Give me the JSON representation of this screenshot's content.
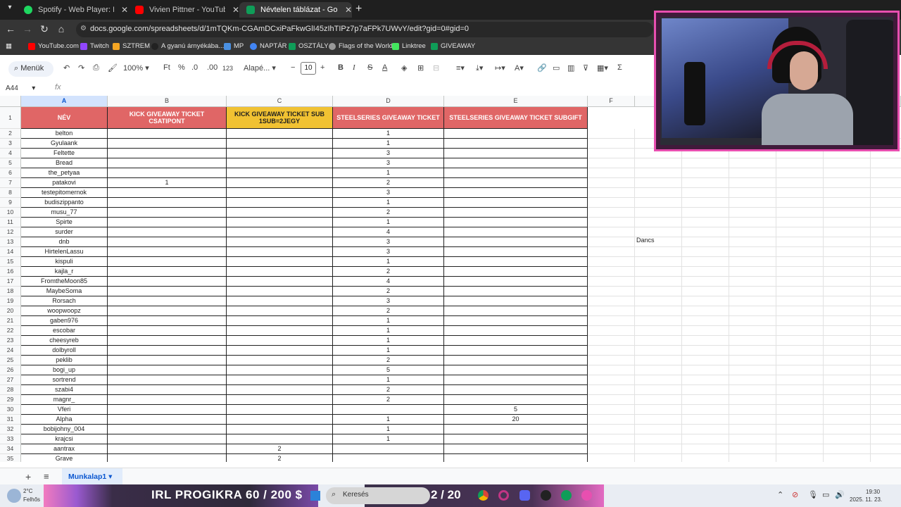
{
  "browser": {
    "tabs": [
      {
        "title": "Spotify - Web Player: Music for",
        "color": "#1ed760",
        "active": false
      },
      {
        "title": "Vivien Pittner - YouTube",
        "color": "#ff0000",
        "active": false
      },
      {
        "title": "Névtelen táblázat - Google Tábl",
        "color": "#0f9d58",
        "active": true
      }
    ],
    "new_tab": "+",
    "url": "docs.google.com/spreadsheets/d/1mTQKm-CGAmDCxiPaFkwGlI45zIhTIPz7p7aFPk7UWvY/edit?gid=0#gid=0",
    "bookmarks": [
      {
        "label": "YouTube.com",
        "color": "#ff0000"
      },
      {
        "label": "Twitch",
        "color": "#9146ff"
      },
      {
        "label": "SZTREM",
        "color": "#f5a623"
      },
      {
        "label": "A gyanú árnyékába...",
        "color": "#222222"
      },
      {
        "label": "MP",
        "color": "#4a90e2"
      },
      {
        "label": "NAPTÁR",
        "color": "#4285f4"
      },
      {
        "label": "OSZTÁLY",
        "color": "#0f9d58"
      },
      {
        "label": "Flags of the World",
        "color": "#999999"
      },
      {
        "label": "Linktree",
        "color": "#43e55e"
      },
      {
        "label": "GIVEAWAY",
        "color": "#0f9d58"
      }
    ]
  },
  "toolbar": {
    "menus": "Menük",
    "zoom": "100%",
    "currency": "Ft",
    "percent": "%",
    "dec_minus": ".0",
    "dec_plus": ".00",
    "num_format": "123",
    "font": "Alapé...",
    "font_size": "10",
    "bold": "B",
    "italic": "I",
    "strike": "S",
    "text_color": "A"
  },
  "formula_bar": {
    "name_box": "A44",
    "fx": "fx",
    "value": ""
  },
  "columns": [
    "A",
    "B",
    "C",
    "D",
    "E",
    "F"
  ],
  "header_row": {
    "A": "NÉV",
    "B": "KICK GIVEAWAY TICKET CSATIPONT",
    "C": "KICK GIVEAWAY TICKET SUB 1SUB=2JEGY",
    "D": "STEELSERIES GIVEAWAY TICKET",
    "E": "STEELSERIES GIVEAWAY TICKET SUBGIFT"
  },
  "rows": [
    {
      "n": "2",
      "a": "belton",
      "b": "",
      "c": "",
      "d": "1",
      "e": ""
    },
    {
      "n": "3",
      "a": "Gyulaank",
      "b": "",
      "c": "",
      "d": "1",
      "e": ""
    },
    {
      "n": "4",
      "a": "Feltette",
      "b": "",
      "c": "",
      "d": "3",
      "e": ""
    },
    {
      "n": "5",
      "a": "Bread",
      "b": "",
      "c": "",
      "d": "3",
      "e": ""
    },
    {
      "n": "6",
      "a": "the_petyaa",
      "b": "",
      "c": "",
      "d": "1",
      "e": ""
    },
    {
      "n": "7",
      "a": "patakovi",
      "b": "1",
      "c": "",
      "d": "2",
      "e": ""
    },
    {
      "n": "8",
      "a": "testepitomernok",
      "b": "",
      "c": "",
      "d": "3",
      "e": ""
    },
    {
      "n": "9",
      "a": "budiszippanto",
      "b": "",
      "c": "",
      "d": "1",
      "e": ""
    },
    {
      "n": "10",
      "a": "musu_77",
      "b": "",
      "c": "",
      "d": "2",
      "e": ""
    },
    {
      "n": "11",
      "a": "Spirte",
      "b": "",
      "c": "",
      "d": "1",
      "e": ""
    },
    {
      "n": "12",
      "a": "surder",
      "b": "",
      "c": "",
      "d": "4",
      "e": ""
    },
    {
      "n": "13",
      "a": "dnb",
      "b": "",
      "c": "",
      "d": "3",
      "e": ""
    },
    {
      "n": "14",
      "a": "HirtelenLassu",
      "b": "",
      "c": "",
      "d": "3",
      "e": ""
    },
    {
      "n": "15",
      "a": "kispuli",
      "b": "",
      "c": "",
      "d": "1",
      "e": ""
    },
    {
      "n": "16",
      "a": "kajla_r",
      "b": "",
      "c": "",
      "d": "2",
      "e": ""
    },
    {
      "n": "17",
      "a": "FromtheMoon85",
      "b": "",
      "c": "",
      "d": "4",
      "e": ""
    },
    {
      "n": "18",
      "a": "MaybeSoma",
      "b": "",
      "c": "",
      "d": "2",
      "e": ""
    },
    {
      "n": "19",
      "a": "Rorsach",
      "b": "",
      "c": "",
      "d": "3",
      "e": ""
    },
    {
      "n": "20",
      "a": "woopwoopz",
      "b": "",
      "c": "",
      "d": "2",
      "e": ""
    },
    {
      "n": "21",
      "a": "gaben976",
      "b": "",
      "c": "",
      "d": "1",
      "e": ""
    },
    {
      "n": "22",
      "a": "escobar",
      "b": "",
      "c": "",
      "d": "1",
      "e": ""
    },
    {
      "n": "23",
      "a": "cheesyreb",
      "b": "",
      "c": "",
      "d": "1",
      "e": ""
    },
    {
      "n": "24",
      "a": "dolbyroll",
      "b": "",
      "c": "",
      "d": "1",
      "e": ""
    },
    {
      "n": "25",
      "a": "peklib",
      "b": "",
      "c": "",
      "d": "2",
      "e": ""
    },
    {
      "n": "26",
      "a": "bogi_up",
      "b": "",
      "c": "",
      "d": "5",
      "e": ""
    },
    {
      "n": "27",
      "a": "sortrend",
      "b": "",
      "c": "",
      "d": "1",
      "e": ""
    },
    {
      "n": "28",
      "a": "szabi4",
      "b": "",
      "c": "",
      "d": "2",
      "e": ""
    },
    {
      "n": "29",
      "a": "magnr_",
      "b": "",
      "c": "",
      "d": "2",
      "e": ""
    },
    {
      "n": "30",
      "a": "Vferi",
      "b": "",
      "c": "",
      "d": "",
      "e": "5"
    },
    {
      "n": "31",
      "a": "Alpha",
      "b": "",
      "c": "",
      "d": "1",
      "e": "20"
    },
    {
      "n": "32",
      "a": "bobijohny_004",
      "b": "",
      "c": "",
      "d": "1",
      "e": ""
    },
    {
      "n": "33",
      "a": "krajcsi",
      "b": "",
      "c": "",
      "d": "1",
      "e": ""
    },
    {
      "n": "34",
      "a": "aantrax",
      "b": "",
      "c": "2",
      "d": "",
      "e": ""
    },
    {
      "n": "35",
      "a": "Grave",
      "b": "",
      "c": "2",
      "d": "",
      "e": ""
    }
  ],
  "overflow_text": "Dancs",
  "sheets": {
    "add": "+",
    "list": "≡",
    "active": "Munkalap1"
  },
  "colors": {
    "header_red": "#e06666",
    "header_yellow": "#f1c232",
    "accent_blue": "#0b57d0"
  },
  "taskbar": {
    "weather_temp": "2°C",
    "weather_desc": "Felhős",
    "banner": "IRL PROGIKRA  60 / 200 $",
    "search": "Keresés",
    "counter": "2 / 20",
    "time": "19:30",
    "date": "2025. 11. 23."
  }
}
